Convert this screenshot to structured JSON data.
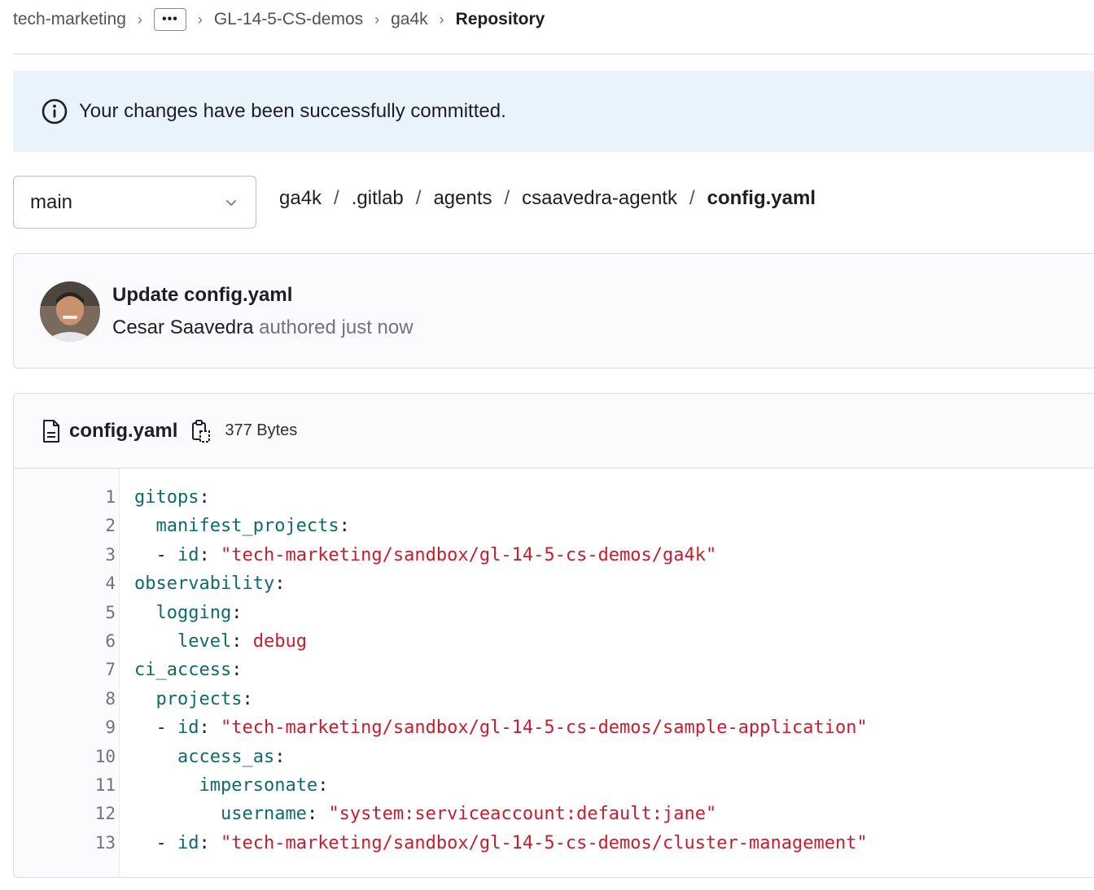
{
  "breadcrumb": {
    "items": [
      "tech-marketing",
      "GL-14-5-CS-demos",
      "ga4k",
      "Repository"
    ],
    "ellipsis": "•••",
    "separator": "›"
  },
  "alert": {
    "message": "Your changes have been successfully committed."
  },
  "branch": {
    "selected": "main"
  },
  "path": {
    "segments": [
      "ga4k",
      ".gitlab",
      "agents",
      "csaavedra-agentk",
      "config.yaml"
    ],
    "separator": "/"
  },
  "commit": {
    "title": "Update config.yaml",
    "author": "Cesar Saavedra",
    "meta": "authored just now"
  },
  "file": {
    "name": "config.yaml",
    "size": "377 Bytes",
    "line_numbers": [
      "1",
      "2",
      "3",
      "4",
      "5",
      "6",
      "7",
      "8",
      "9",
      "10",
      "11",
      "12",
      "13"
    ],
    "lines": [
      [
        {
          "t": "k",
          "v": "gitops"
        },
        {
          "t": "p",
          "v": ":"
        }
      ],
      [
        {
          "t": "p",
          "v": "  "
        },
        {
          "t": "k",
          "v": "manifest_projects"
        },
        {
          "t": "p",
          "v": ":"
        }
      ],
      [
        {
          "t": "p",
          "v": "  - "
        },
        {
          "t": "k",
          "v": "id"
        },
        {
          "t": "p",
          "v": ": "
        },
        {
          "t": "s",
          "v": "\"tech-marketing/sandbox/gl-14-5-cs-demos/ga4k\""
        }
      ],
      [
        {
          "t": "k",
          "v": "observability"
        },
        {
          "t": "p",
          "v": ":"
        }
      ],
      [
        {
          "t": "p",
          "v": "  "
        },
        {
          "t": "k",
          "v": "logging"
        },
        {
          "t": "p",
          "v": ":"
        }
      ],
      [
        {
          "t": "p",
          "v": "    "
        },
        {
          "t": "k",
          "v": "level"
        },
        {
          "t": "p",
          "v": ": "
        },
        {
          "t": "s",
          "v": "debug"
        }
      ],
      [
        {
          "t": "k",
          "v": "ci_access"
        },
        {
          "t": "p",
          "v": ":"
        }
      ],
      [
        {
          "t": "p",
          "v": "  "
        },
        {
          "t": "k",
          "v": "projects"
        },
        {
          "t": "p",
          "v": ":"
        }
      ],
      [
        {
          "t": "p",
          "v": "  - "
        },
        {
          "t": "k",
          "v": "id"
        },
        {
          "t": "p",
          "v": ": "
        },
        {
          "t": "s",
          "v": "\"tech-marketing/sandbox/gl-14-5-cs-demos/sample-application\""
        }
      ],
      [
        {
          "t": "p",
          "v": "    "
        },
        {
          "t": "k",
          "v": "access_as"
        },
        {
          "t": "p",
          "v": ":"
        }
      ],
      [
        {
          "t": "p",
          "v": "      "
        },
        {
          "t": "k",
          "v": "impersonate"
        },
        {
          "t": "p",
          "v": ":"
        }
      ],
      [
        {
          "t": "p",
          "v": "        "
        },
        {
          "t": "k",
          "v": "username"
        },
        {
          "t": "p",
          "v": ": "
        },
        {
          "t": "s",
          "v": "\"system:serviceaccount:default:jane\""
        }
      ],
      [
        {
          "t": "p",
          "v": "  - "
        },
        {
          "t": "k",
          "v": "id"
        },
        {
          "t": "p",
          "v": ": "
        },
        {
          "t": "s",
          "v": "\"tech-marketing/sandbox/gl-14-5-cs-demos/cluster-management\""
        }
      ]
    ]
  },
  "colors": {
    "alert_bg": "#e9f3fc",
    "code_key": "#0e6b6b",
    "code_string": "#c91c2e"
  },
  "icons": {
    "alert": "info-circle-icon",
    "branch": "chevron-down-icon",
    "file": "document-icon",
    "copy": "copy-to-clipboard-icon"
  }
}
